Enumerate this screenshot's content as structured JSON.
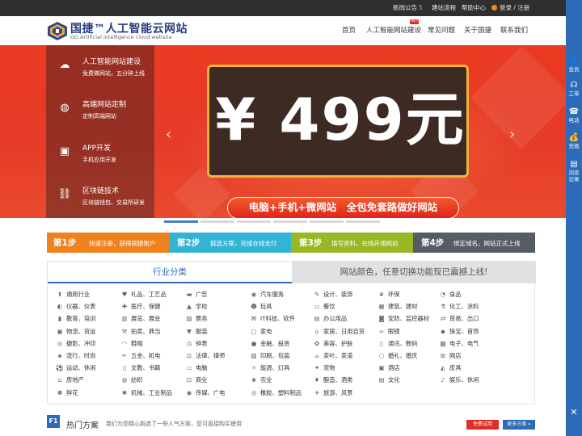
{
  "topbar": {
    "notice_label": "新闻公告",
    "notice_count": "5",
    "links": [
      "建站流程",
      "帮助中心"
    ],
    "login_label": "登录 / 注册"
  },
  "logo": {
    "title": "国捷™人工智能云网站",
    "subtitle": "GG Artificial intelligence cloud website"
  },
  "nav": {
    "items": [
      "首页",
      "人工智能网站建设",
      "常见问题",
      "关于国捷",
      "联系我们"
    ],
    "hot_badge": "HOT"
  },
  "banner": {
    "services": [
      {
        "icon": "cloud-icon",
        "title": "人工智能网站建设",
        "desc": "免费做网站，五分钟上线"
      },
      {
        "icon": "globe-icon",
        "title": "高端网站定制",
        "desc": "定制高端网站"
      },
      {
        "icon": "app-icon",
        "title": "APP开发",
        "desc": "手机应用开发"
      },
      {
        "icon": "blockchain-icon",
        "title": "区块链技术",
        "desc": "区块链钱包、交易所研发"
      }
    ],
    "price_text": "¥ 499元",
    "slogan": "电脑+手机+微网站　全包免套路做好网站",
    "slide_count": 6,
    "active_slide": 1
  },
  "steps": [
    {
      "num": "第1步",
      "desc": "快速注册，获得国捷账户",
      "color": "#f0821e"
    },
    {
      "num": "第2步",
      "desc": "挑选方案，完成在线支付",
      "color": "#33b4d4"
    },
    {
      "num": "第3步",
      "desc": "填写资料，在线开通网站",
      "color": "#98b826"
    },
    {
      "num": "第4步",
      "desc": "绑定域名，网站正式上线",
      "color": "#555c66"
    }
  ],
  "tabs": {
    "industry": "行业分类",
    "colors": "网站颜色，任意切换功能现已震撼上线!"
  },
  "industries": [
    "通用行业",
    "礼品、工艺品",
    "广告",
    "汽车服务",
    "设计、装饰",
    "环保",
    "食品",
    "仪器、仪表",
    "医疗、保健",
    "学校",
    "玩具",
    "餐饮",
    "建筑、建材",
    "化工、涂料",
    "教育、培训",
    "展览、展会",
    "票务",
    "IT科技、软件",
    "办公用品",
    "安防、监控器材",
    "贸易、出口",
    "物流、货运",
    "拍卖、典当",
    "服装",
    "家电",
    "家居、日用百货",
    "眼镜",
    "珠宝、首饰",
    "摄影、冲印",
    "鞋帽",
    "钟表",
    "金融、投资",
    "美容、护肤",
    "通讯、数码",
    "电子、电气",
    "流行、时尚",
    "五金、机电",
    "法律、律师",
    "印刷、包装",
    "茶叶、茶道",
    "婚礼、婚庆",
    "网店",
    "运动、休闲",
    "文教、书籍",
    "电脑",
    "能源、灯具",
    "宠物",
    "酒店",
    "皮具",
    "房地产",
    "纺织",
    "商业",
    "农业",
    "酿造、酒类",
    "文化",
    "娱乐、休闲",
    "鲜花",
    "机械、工业制品",
    "传媒、广电",
    "橡胶、塑料制品",
    "旅游、风景"
  ],
  "industry_icons": [
    "pin-icon",
    "heart-icon",
    "ad-icon",
    "car-icon",
    "paint-icon",
    "leaf-icon",
    "food-icon",
    "gauge-icon",
    "medical-icon",
    "school-icon",
    "toy-icon",
    "dining-icon",
    "building-icon",
    "flask-icon",
    "book-icon",
    "exhibit-icon",
    "ticket-icon",
    "code-icon",
    "printer-icon",
    "camera-icon",
    "trade-icon",
    "truck-icon",
    "gavel-icon",
    "shirt-icon",
    "tv-icon",
    "home-icon",
    "glasses-icon",
    "diamond-icon",
    "photo-icon",
    "hat-icon",
    "clock-icon",
    "coin-icon",
    "beauty-icon",
    "phone-icon",
    "chip-icon",
    "fashion-icon",
    "tools-icon",
    "law-icon",
    "package-icon",
    "tea-icon",
    "ring-icon",
    "shop-icon",
    "sport-icon",
    "book2-icon",
    "computer-icon",
    "lamp-icon",
    "pet-icon",
    "hotel-icon",
    "bag-icon",
    "house-icon",
    "yarn-icon",
    "cart-icon",
    "farm-icon",
    "wine-icon",
    "culture-icon",
    "music-icon",
    "flower-icon",
    "gear-icon",
    "broadcast-icon",
    "tyre-icon",
    "travel-icon"
  ],
  "hot_section": {
    "badge": "F1",
    "title": "热门方案",
    "subtitle": "我们为您精心挑选了一些人气方案，您可直接购买使用",
    "free_btn": "免费试用",
    "more_btn": "更多方案 »"
  },
  "sidebar": {
    "items": [
      "会员",
      "工单",
      "电话",
      "充值",
      "浏览记录"
    ]
  },
  "colors": {
    "brand_blue": "#2b6bb8",
    "banner_red": "#e53b28",
    "price_gold": "#f0b33a"
  }
}
